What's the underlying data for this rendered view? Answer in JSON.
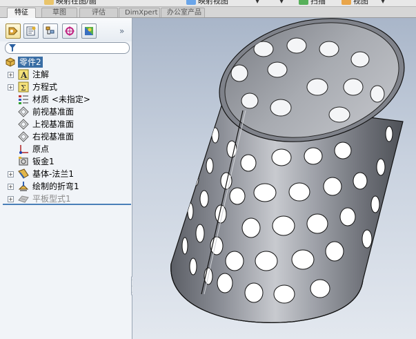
{
  "toolbar": {
    "items": [
      {
        "label": "映射在图/画",
        "icon": "layers-icon"
      },
      {
        "label": "映射视图",
        "icon": "view-icon"
      },
      {
        "label": "扫描",
        "icon": "scan-icon"
      },
      {
        "label": "视图",
        "icon": "display-icon"
      }
    ]
  },
  "command_tabs": [
    {
      "label": "特征",
      "active": true
    },
    {
      "label": "草图",
      "active": false
    },
    {
      "label": "评估",
      "active": false
    },
    {
      "label": "DimXpert",
      "active": false
    },
    {
      "label": "办公室产品",
      "active": false
    }
  ],
  "panel": {
    "tabs": [
      "feature-manager-icon",
      "property-manager-icon",
      "configuration-manager-icon",
      "dimxpert-manager-icon",
      "display-manager-icon"
    ],
    "more_glyph": "»"
  },
  "tree": {
    "root": "零件2",
    "items": [
      {
        "label": "注解",
        "icon": "annotation-icon",
        "expandable": true
      },
      {
        "label": "方程式",
        "icon": "equation-icon",
        "expandable": true
      },
      {
        "label": "材质 <未指定>",
        "icon": "material-icon",
        "expandable": false
      },
      {
        "label": "前视基准面",
        "icon": "plane-icon",
        "expandable": false
      },
      {
        "label": "上视基准面",
        "icon": "plane-icon",
        "expandable": false
      },
      {
        "label": "右视基准面",
        "icon": "plane-icon",
        "expandable": false
      },
      {
        "label": "原点",
        "icon": "origin-icon",
        "expandable": false
      },
      {
        "label": "钣金1",
        "icon": "sheet-metal-icon",
        "expandable": false
      },
      {
        "label": "基体-法兰1",
        "icon": "base-flange-icon",
        "expandable": true
      },
      {
        "label": "绘制的折弯1",
        "icon": "sketched-bend-icon",
        "expandable": true
      },
      {
        "label": "平板型式1",
        "icon": "flat-pattern-icon",
        "expandable": true,
        "suppressed": true
      }
    ]
  },
  "colors": {
    "accent": "#3a6ea5",
    "rollback_bar": "#4a7fb8",
    "model_metal": "#8c8e96"
  }
}
